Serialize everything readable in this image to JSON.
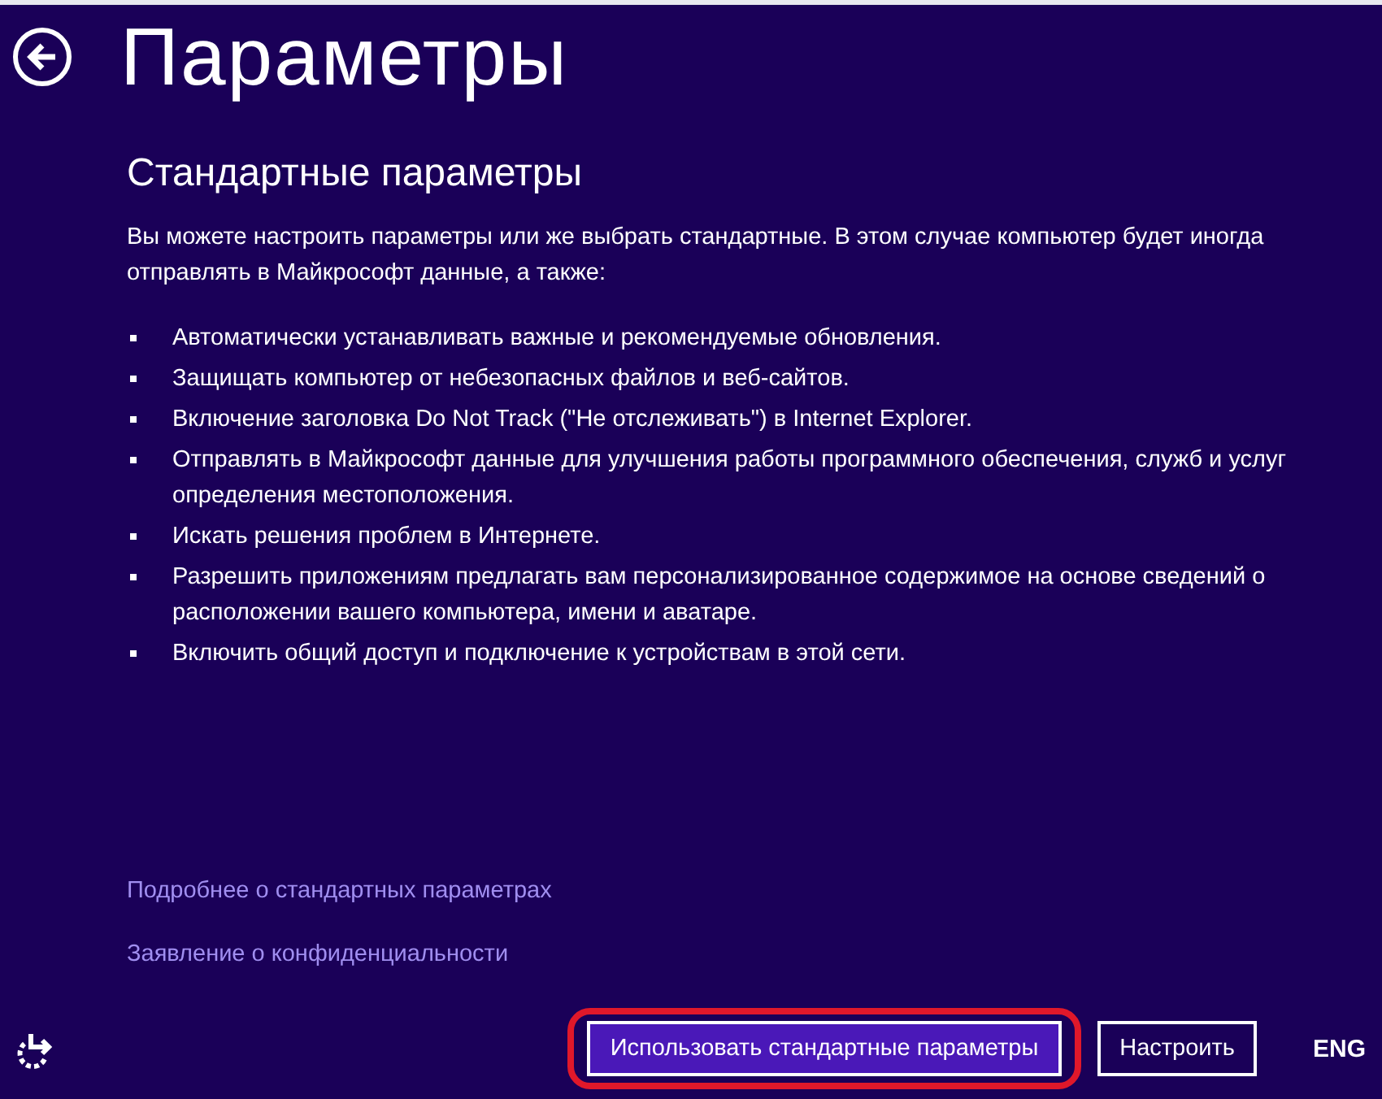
{
  "title": "Параметры",
  "section_title": "Стандартные параметры",
  "intro": "Вы можете настроить параметры или же выбрать стандартные. В этом случае компьютер будет иногда отправлять в Майкрософт данные, а также:",
  "bullets": [
    "Автоматически устанавливать важные и рекомендуемые обновления.",
    "Защищать компьютер от небезопасных файлов и веб-сайтов.",
    "Включение заголовка Do Not Track (\"Не отслеживать\") в Internet Explorer.",
    "Отправлять в Майкрософт данные для улучшения работы программного обеспечения, служб и услуг определения местоположения.",
    "Искать решения проблем в Интернете.",
    "Разрешить приложениям предлагать вам персонализированное содержимое на основе сведений о расположении вашего компьютера, имени и аватаре.",
    "Включить общий доступ и подключение к устройствам в этой сети."
  ],
  "links": [
    "Подробнее о стандартных параметрах",
    "Заявление о конфиденциальности"
  ],
  "buttons": [
    {
      "label": "Использовать стандартные параметры",
      "kind": "primary",
      "highlighted": true
    },
    {
      "label": "Настроить",
      "kind": "secondary",
      "highlighted": false
    }
  ],
  "language": "ENG"
}
